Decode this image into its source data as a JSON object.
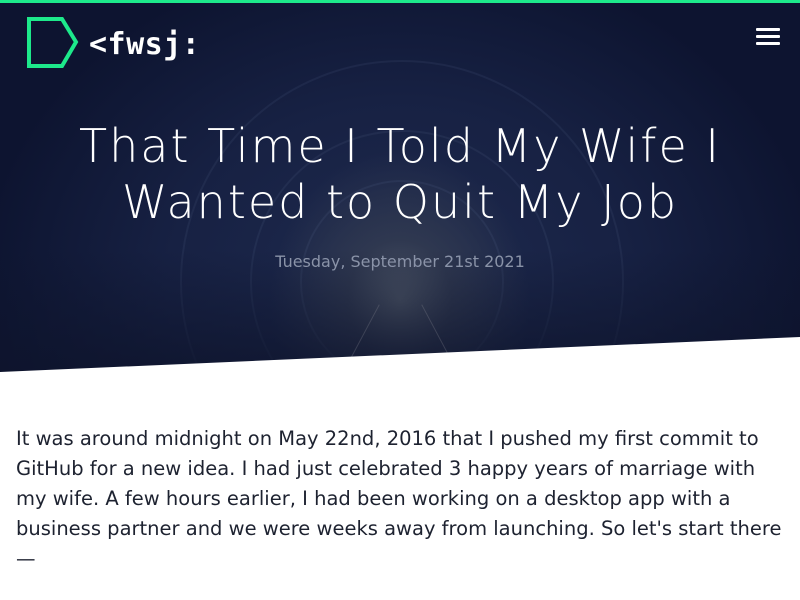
{
  "header": {
    "logo_text": "<fwsj:",
    "menu_icon": "hamburger-menu-icon",
    "logo_icon": "pentagon-logo-icon"
  },
  "post": {
    "title": "That Time I Told My Wife I Wanted to Quit My Job",
    "date": "Tuesday, September 21st 2021",
    "body": "It was around midnight on May 22nd, 2016 that I pushed my first commit to GitHub for a new idea. I had just celebrated 3 happy years of marriage with my wife. A few hours earlier, I had been working on a desktop app with a business partner and we were weeks away from launching. So let's start there —"
  },
  "colors": {
    "accent": "#1de98b",
    "hero_dark": "#172143",
    "text": "#1d2230",
    "date": "#8a93a8"
  }
}
